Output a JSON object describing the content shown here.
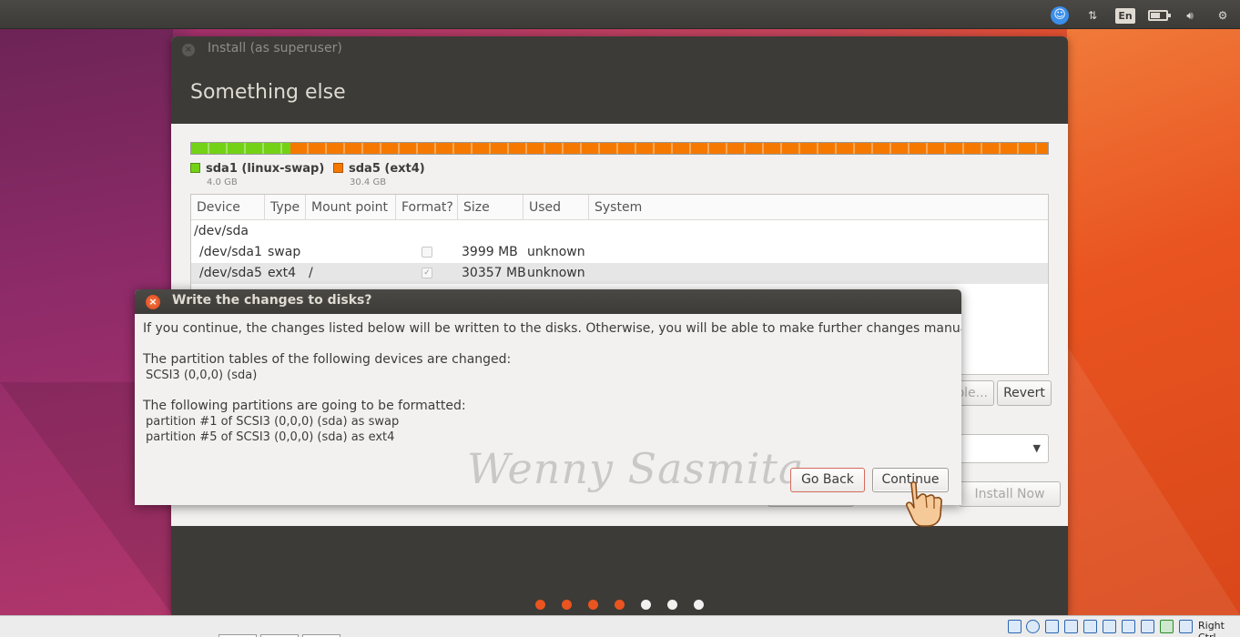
{
  "top_panel": {
    "language": "En",
    "indicators": [
      "accessibility-icon",
      "network-icon",
      "keyboard-language",
      "battery-icon",
      "volume-icon",
      "system-gear-icon"
    ]
  },
  "installer": {
    "window_title": "Install (as superuser)",
    "page_title": "Something else",
    "partitions_bar": [
      {
        "name": "sda1 (linux-swap)",
        "size": "4.0 GB",
        "color": "#73d216",
        "fraction": 0.116
      },
      {
        "name": "sda5 (ext4)",
        "size": "30.4 GB",
        "color": "#f57900",
        "fraction": 0.884
      }
    ],
    "table": {
      "headers": [
        "Device",
        "Type",
        "Mount point",
        "Format?",
        "Size",
        "Used",
        "System"
      ],
      "rows": [
        {
          "device": "/dev/sda",
          "type": "",
          "mount": "",
          "format": null,
          "size": "",
          "used": "",
          "system": ""
        },
        {
          "device": "/dev/sda1",
          "type": "swap",
          "mount": "",
          "format": false,
          "size": "3999 MB",
          "used": "unknown",
          "system": ""
        },
        {
          "device": "/dev/sda5",
          "type": "ext4",
          "mount": "/",
          "format": true,
          "size": "30357 MB",
          "used": "unknown",
          "system": ""
        }
      ]
    },
    "partial_button_label": "ole...",
    "revert_label": "Revert",
    "install_now_label": "Install Now",
    "progress_dots": [
      {
        "state": "done",
        "color": "#e95420"
      },
      {
        "state": "done",
        "color": "#e95420"
      },
      {
        "state": "done",
        "color": "#e95420"
      },
      {
        "state": "done",
        "color": "#e95420"
      },
      {
        "state": "pending",
        "color": "#f2f1f0"
      },
      {
        "state": "pending",
        "color": "#f2f1f0"
      },
      {
        "state": "pending",
        "color": "#f2f1f0"
      }
    ]
  },
  "dialog": {
    "title": "Write the changes to disks?",
    "message": "If you continue, the changes listed below will be written to the disks. Otherwise, you will be able to make further changes manually.",
    "tables_heading": "The partition tables of the following devices are changed:",
    "tables_items": [
      " SCSI3 (0,0,0) (sda)"
    ],
    "formatted_heading": "The following partitions are going to be formatted:",
    "formatted_items": [
      " partition #1 of SCSI3 (0,0,0) (sda) as swap",
      " partition #5 of SCSI3 (0,0,0) (sda) as ext4"
    ],
    "watermark": "Wenny Sasmita",
    "go_back_label": "Go Back",
    "continue_label": "Continue"
  },
  "bottom_bar": {
    "host_key": "Right Ctrl"
  }
}
